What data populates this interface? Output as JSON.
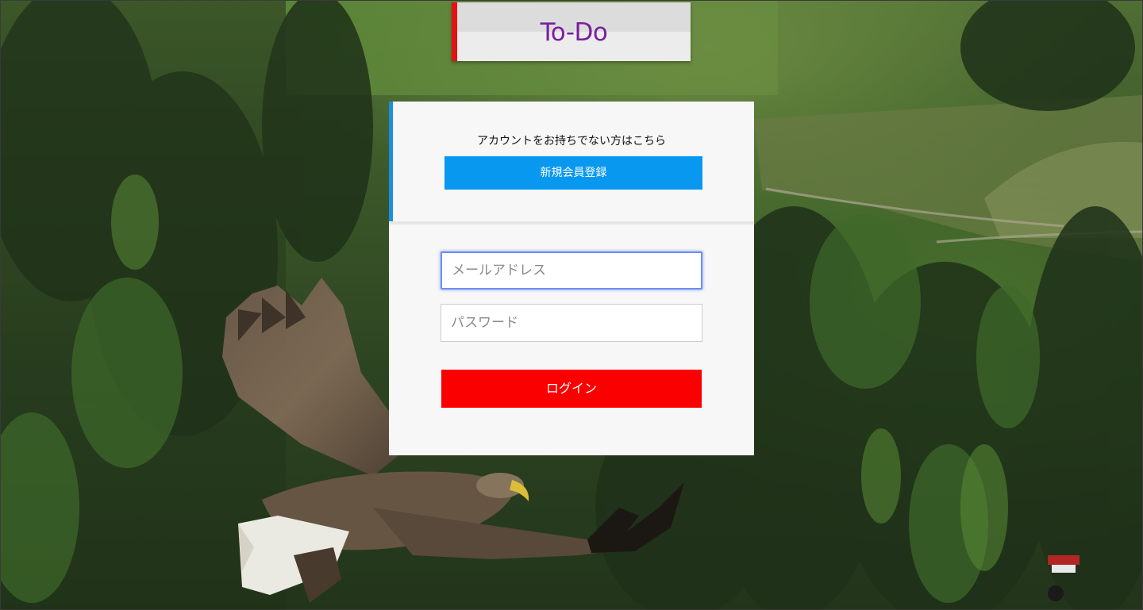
{
  "header": {
    "logo_text": "To-Do"
  },
  "signup": {
    "prompt_text": "アカウントをお持ちでない方はこちら",
    "button_label": "新規会員登録"
  },
  "login_form": {
    "email_placeholder": "メールアドレス",
    "email_value": "",
    "password_placeholder": "パスワード",
    "password_value": "",
    "submit_label": "ログイン"
  },
  "colors": {
    "logo_text": "#7a1fa0",
    "logo_accent": "#e41212",
    "card_accent": "#1a8ee0",
    "signup_button": "#0898f0",
    "login_button": "#fa0000",
    "email_focus_ring": "#6d8ef0"
  },
  "background": {
    "subject": "eagle-flying-over-forest"
  }
}
